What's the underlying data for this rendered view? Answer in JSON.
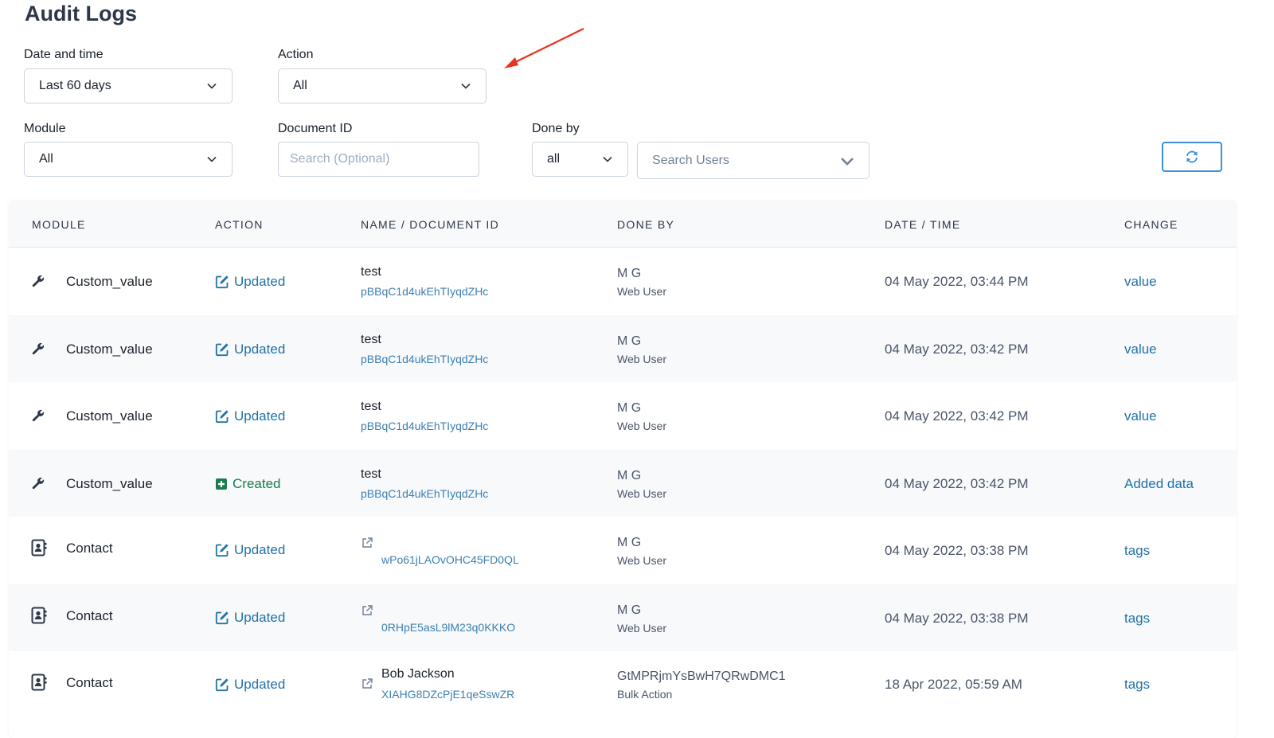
{
  "page": {
    "title": "Audit Logs"
  },
  "filters": {
    "date_label": "Date and time",
    "date_value": "Last 60 days",
    "action_label": "Action",
    "action_value": "All",
    "module_label": "Module",
    "module_value": "All",
    "document_label": "Document ID",
    "document_placeholder": "Search (Optional)",
    "done_by_label": "Done by",
    "done_by_value": "all",
    "users_placeholder": "Search Users"
  },
  "colors": {
    "accent": "#2172a8",
    "created": "#1e7a4f",
    "annotation_arrow": "#e8321e",
    "refresh_border": "#3d8fd6"
  },
  "table": {
    "headers": {
      "module": "MODULE",
      "action": "ACTION",
      "name": "NAME / DOCUMENT ID",
      "done_by": "DONE BY",
      "date": "DATE / TIME",
      "change": "CHANGE"
    },
    "rows": [
      {
        "module_icon": "wrench-icon",
        "module": "Custom_value",
        "action": "Updated",
        "doc_name": "test",
        "doc_id": "pBBqC1d4ukEhTIyqdZHc",
        "done_name": "M G",
        "done_sub": "Web User",
        "datetime": "04 May 2022, 03:44 PM",
        "change": "value"
      },
      {
        "module_icon": "wrench-icon",
        "module": "Custom_value",
        "action": "Updated",
        "doc_name": "test",
        "doc_id": "pBBqC1d4ukEhTIyqdZHc",
        "done_name": "M G",
        "done_sub": "Web User",
        "datetime": "04 May 2022, 03:42 PM",
        "change": "value"
      },
      {
        "module_icon": "wrench-icon",
        "module": "Custom_value",
        "action": "Updated",
        "doc_name": "test",
        "doc_id": "pBBqC1d4ukEhTIyqdZHc",
        "done_name": "M G",
        "done_sub": "Web User",
        "datetime": "04 May 2022, 03:42 PM",
        "change": "value"
      },
      {
        "module_icon": "wrench-icon",
        "module": "Custom_value",
        "action": "Created",
        "doc_name": "test",
        "doc_id": "pBBqC1d4ukEhTIyqdZHc",
        "done_name": "M G",
        "done_sub": "Web User",
        "datetime": "04 May 2022, 03:42 PM",
        "change": "Added data"
      },
      {
        "module_icon": "contact-book-icon",
        "module": "Contact",
        "action": "Updated",
        "doc_name": "",
        "doc_id": "wPo61jLAOvOHC45FD0QL",
        "done_name": "M G",
        "done_sub": "Web User",
        "datetime": "04 May 2022, 03:38 PM",
        "change": "tags"
      },
      {
        "module_icon": "contact-book-icon",
        "module": "Contact",
        "action": "Updated",
        "doc_name": "",
        "doc_id": "0RHpE5asL9lM23q0KKKO",
        "done_name": "M G",
        "done_sub": "Web User",
        "datetime": "04 May 2022, 03:38 PM",
        "change": "tags"
      },
      {
        "module_icon": "contact-book-icon",
        "module": "Contact",
        "action": "Updated",
        "doc_name": "Bob Jackson",
        "doc_id": "XIAHG8DZcPjE1qeSswZR",
        "done_name": "GtMPRjmYsBwH7QRwDMC1",
        "done_sub": "Bulk Action",
        "datetime": "18 Apr 2022, 05:59 AM",
        "change": "tags"
      }
    ]
  }
}
